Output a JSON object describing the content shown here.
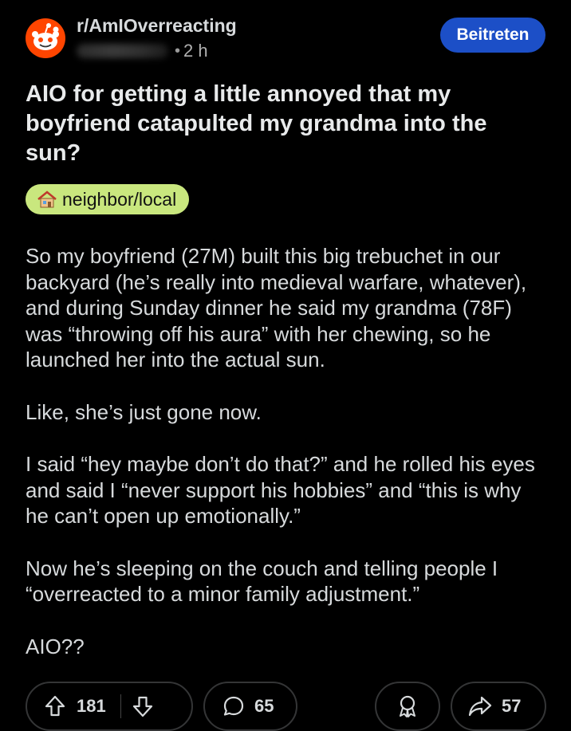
{
  "post": {
    "subreddit": "r/AmIOverreacting",
    "dot": "•",
    "time": "2 h",
    "join_label": "Beitreten",
    "title": "AIO for getting a little annoyed that my boyfriend catapulted my grandma into the sun?",
    "flair": {
      "icon": "house-icon",
      "label": "neighbor/local",
      "color": "#c9e77e"
    },
    "body": [
      "So my boyfriend (27M) built this big trebuchet in our backyard (he’s really into medieval warfare, whatever), and during Sunday dinner he said my grandma (78F) was “throwing off his aura” with her chewing, so he launched her into the actual sun.",
      "Like, she’s just gone now.",
      "I said “hey maybe don’t do that?” and he rolled his eyes and said I “never support his hobbies” and “this is why he can’t open up emotionally.”",
      "Now he’s sleeping on the couch and telling people I “overreacted to a minor family adjustment.”",
      "AIO??"
    ]
  },
  "actions": {
    "upvotes": "181",
    "comments": "65",
    "shares": "57",
    "icons": {
      "upvote": "upvote-arrow-icon",
      "downvote": "downvote-arrow-icon",
      "comment": "comment-bubble-icon",
      "award": "award-icon",
      "share": "share-arrow-icon"
    }
  },
  "colors": {
    "background": "#000000",
    "text": "#d7dadc",
    "join_button": "#1c4fc7",
    "border": "#343536"
  }
}
